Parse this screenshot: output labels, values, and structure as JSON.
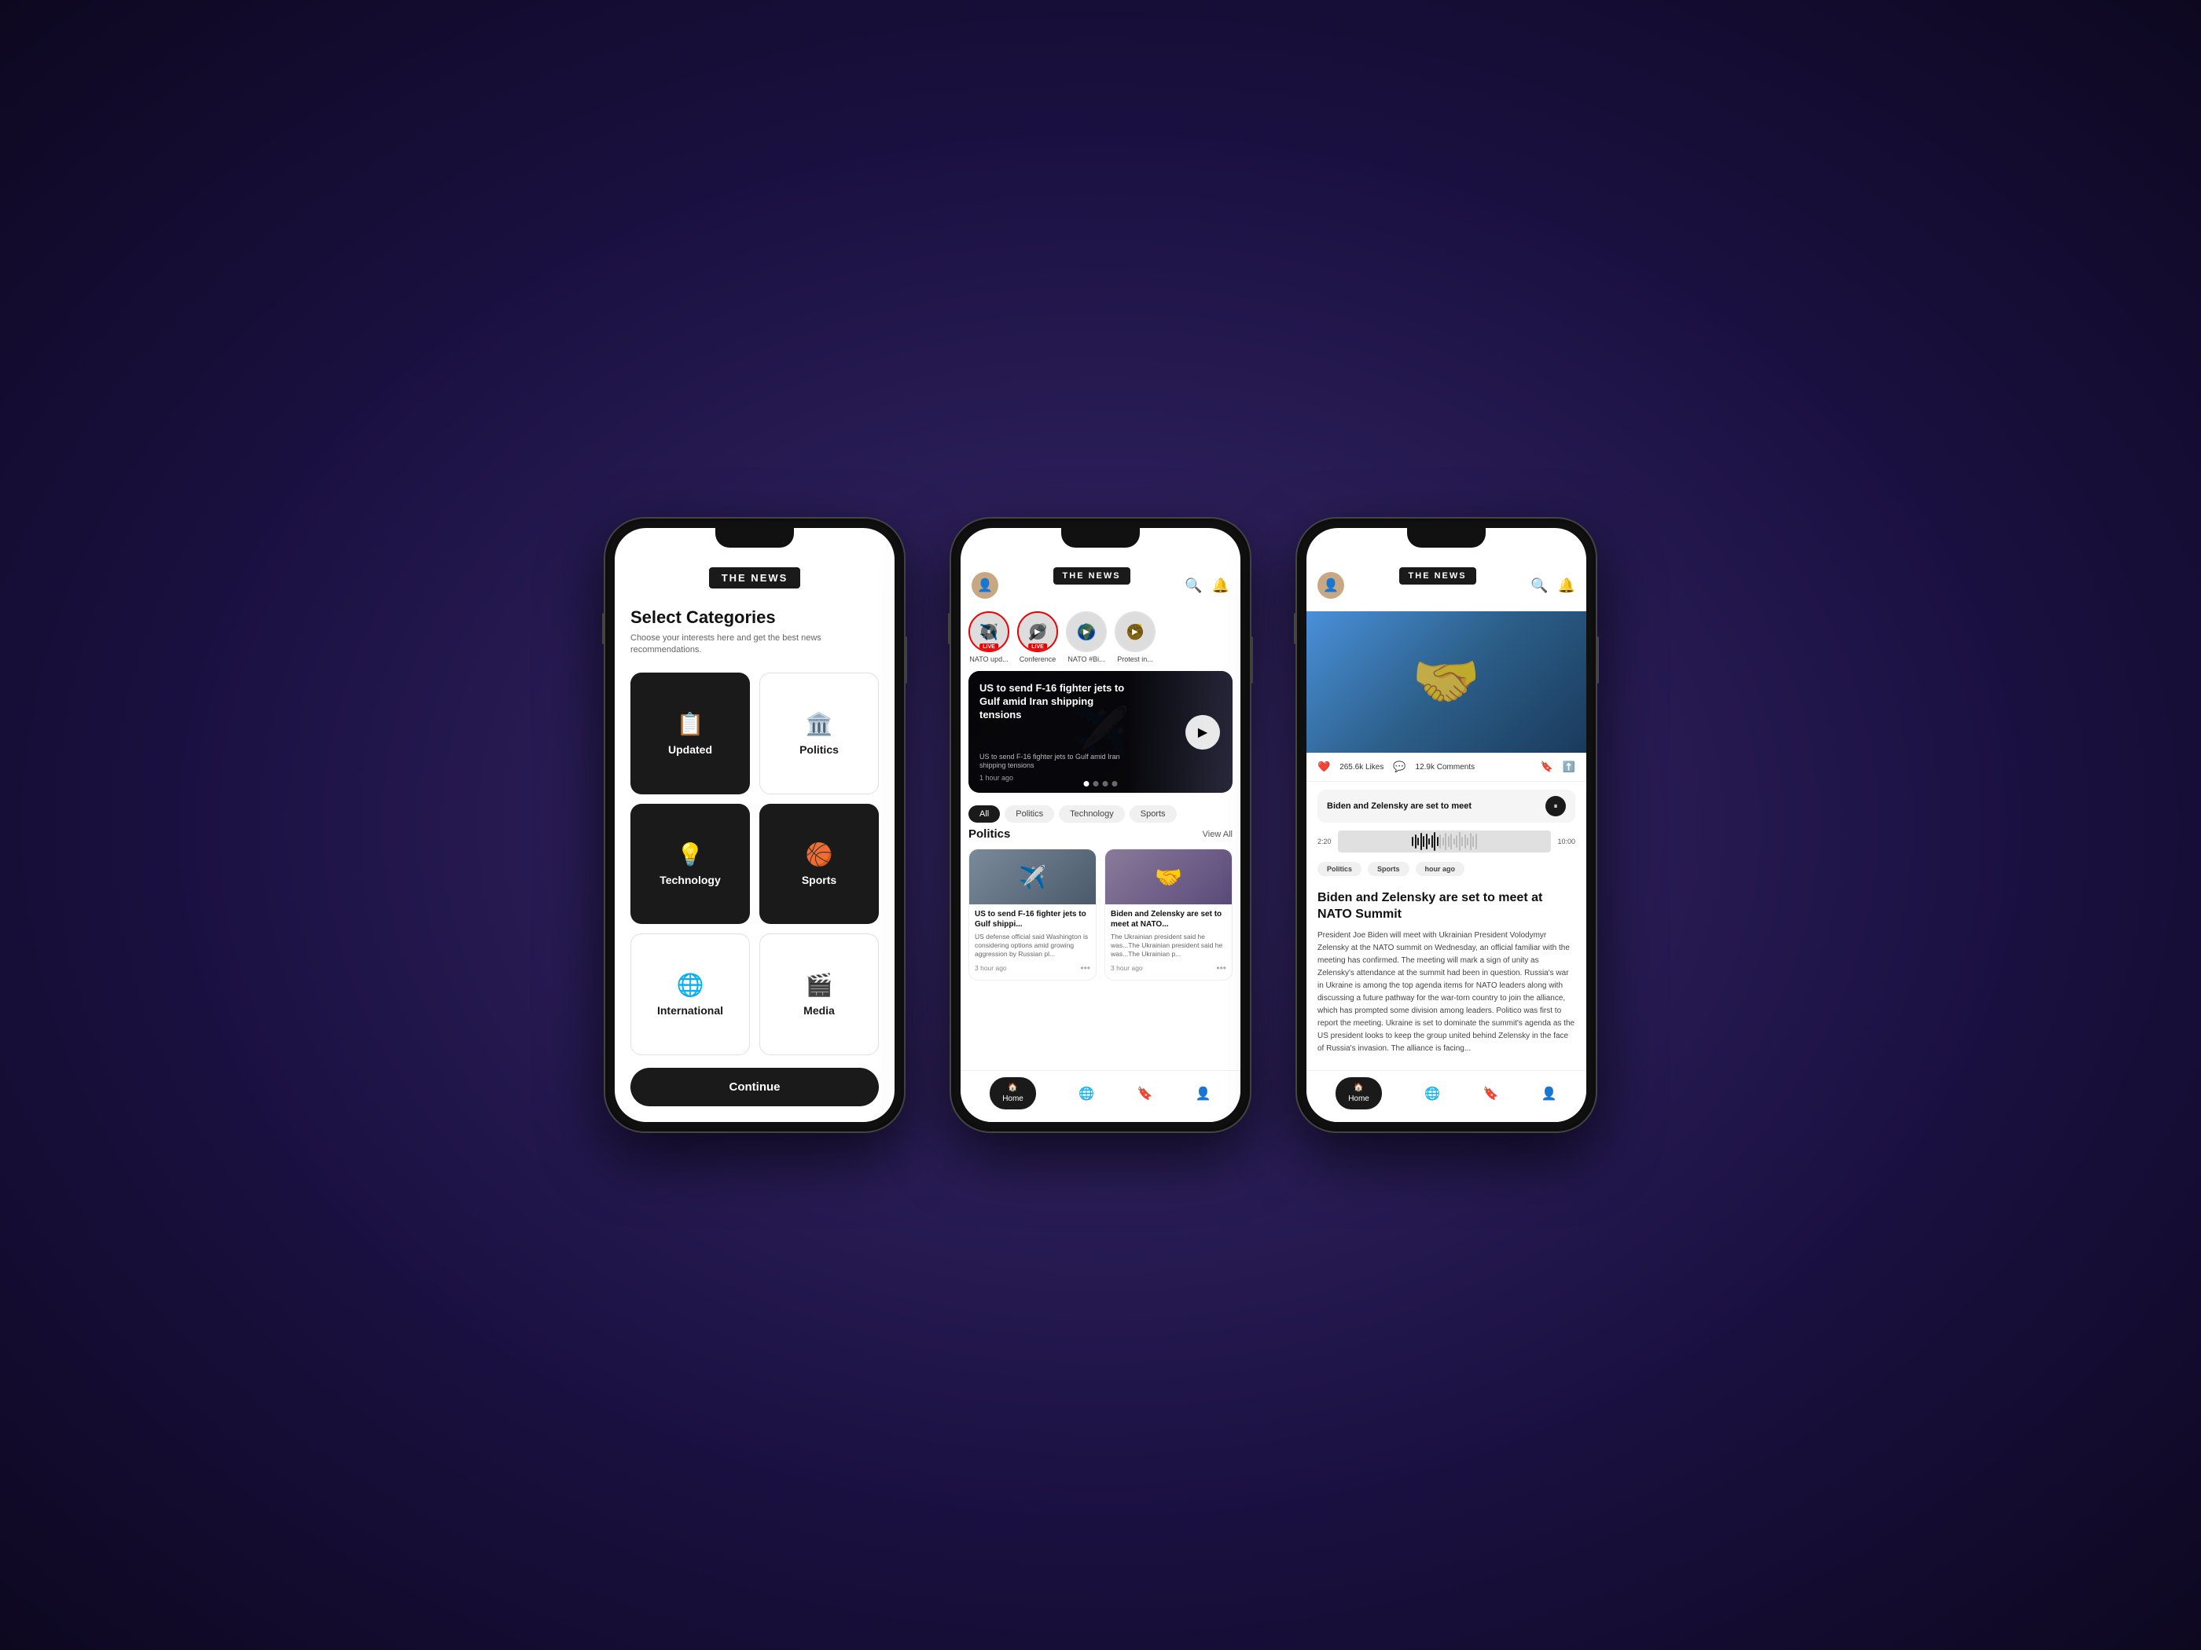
{
  "app": {
    "logo": "THE NEWS",
    "background": "#1a1040"
  },
  "phone1": {
    "title": "Select Categories",
    "subtitle": "Choose your interests here and get the best news recommendations.",
    "categories": [
      {
        "id": "updated",
        "label": "Updated",
        "icon": "📋",
        "selected": true
      },
      {
        "id": "politics",
        "label": "Politics",
        "icon": "🏛️",
        "selected": true
      },
      {
        "id": "technology",
        "label": "Technology",
        "icon": "💡",
        "selected": true
      },
      {
        "id": "sports",
        "label": "Sports",
        "icon": "🏀",
        "selected": true
      },
      {
        "id": "international",
        "label": "International",
        "icon": "🌐",
        "selected": false
      },
      {
        "id": "media",
        "label": "Media",
        "icon": "🎬",
        "selected": false
      }
    ],
    "continue_btn": "Continue"
  },
  "phone2": {
    "stories": [
      {
        "label": "NATO upd...",
        "live": true,
        "icon": "✈️"
      },
      {
        "label": "Conference",
        "live": true,
        "icon": "🎤"
      },
      {
        "label": "NATO #Bi...",
        "live": false,
        "icon": "🌍"
      },
      {
        "label": "Protest in...",
        "live": false,
        "icon": "✊"
      }
    ],
    "hero": {
      "title": "US to send F-16 fighter jets to Gulf amid Iran shipping tensions",
      "subtitle": "US to send F-16 fighter jets to Gulf amid Iran shipping tensions",
      "time": "1 hour ago"
    },
    "filters": [
      "All",
      "Politics",
      "Technology",
      "Sports"
    ],
    "active_filter": "All",
    "section_title": "Politics",
    "view_all": "View All",
    "cards": [
      {
        "title": "US to send F-16 fighter jets to Gulf shippi...",
        "desc": "US defense official said Washington is considering options amid growing aggression by Russian pl...",
        "time": "3 hour ago",
        "icon": "✈️"
      },
      {
        "title": "Biden and Zelensky are set to meet at NATO...",
        "desc": "The Ukrainian president said he was...The Ukrainian president said he was...The Ukrainian p...",
        "time": "3 hour ago",
        "icon": "🤝"
      }
    ],
    "nav": {
      "home": "Home",
      "globe": "🌐",
      "bookmark": "🔖",
      "profile": "👤"
    }
  },
  "phone3": {
    "article": {
      "likes": "265.6k Likes",
      "comments": "12.9k Comments",
      "audio_title": "Biden and Zelensky are set to meet",
      "audio_current": "2:20",
      "audio_total": "10:00",
      "title": "Biden and Zelensky are set to meet at NATO Summit",
      "body": "President Joe Biden will meet with Ukrainian President Volodymyr Zelensky at the NATO summit on Wednesday, an official familiar with the meeting has confirmed.\nThe meeting will mark a sign of unity as Zelensky's attendance at the summit had been in question. Russia's war in Ukraine is among the top agenda items for NATO leaders along with discussing a future pathway for the war-torn country to join the alliance, which has prompted some division among leaders.\nPolitico was first to report the meeting.\nUkraine is set to dominate the summit's agenda as the US president looks to keep the group united behind Zelensky in the face of Russia's invasion. The alliance is facing...",
      "tags": [
        "Politics",
        "Sports"
      ],
      "tag_time": "hour ago"
    },
    "nav": {
      "home": "Home",
      "globe": "🌐",
      "bookmark": "🔖",
      "profile": "👤"
    }
  }
}
